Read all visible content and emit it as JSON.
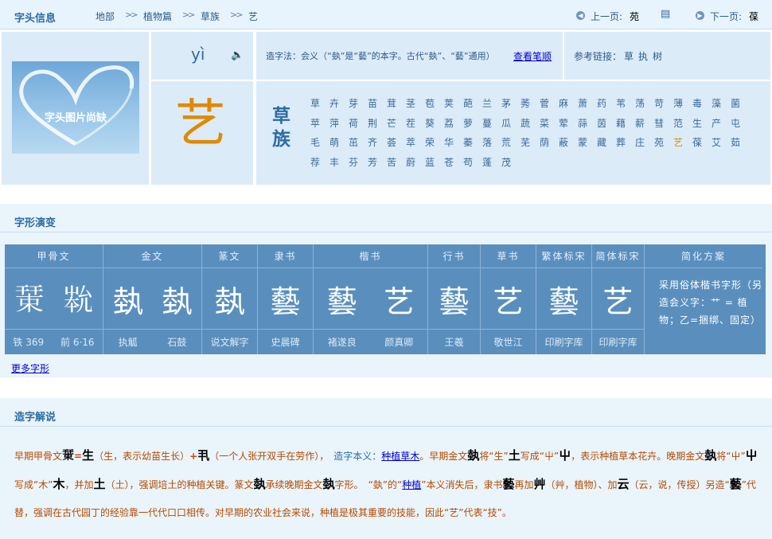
{
  "topbar": {
    "title": "字头信息",
    "bc1": "地部",
    "bc2": "植物篇",
    "bc3": "草族",
    "bc4": "艺",
    "sep": ">>",
    "prev_label": "上一页:",
    "prev_char": "苑",
    "next_label": "下一页:",
    "next_char": "葆"
  },
  "info": {
    "image_caption": "字头图片尚缺",
    "pinyin": "yì",
    "method_text": "造字法：会义（“埶”是“藝”的本字。古代“埶”、“藝”通用）",
    "stroke_link": "查看笔顺",
    "ref_label": "参考链接：",
    "ref1": "草",
    "ref2": "执",
    "ref3": "树",
    "big_char": "艺",
    "radical_name": "草族"
  },
  "radical_chars": [
    "草",
    "卉",
    "芽",
    "苗",
    "茸",
    "茎",
    "苞",
    "荚",
    "葩",
    "兰",
    "茅",
    "莠",
    "菅",
    "麻",
    "萧",
    "药",
    "苇",
    "荡",
    "苛",
    "薄",
    "毒",
    "藻",
    "菌",
    "苹",
    "萍",
    "荷",
    "荆",
    "芒",
    "茬",
    "葵",
    "荔",
    "萝",
    "蔓",
    "瓜",
    "蔬",
    "菜",
    "荤",
    "蒜",
    "茵",
    "藉",
    "薪",
    "彗",
    "范",
    "生",
    "产",
    "屯",
    "毛",
    "萌",
    "茁",
    "齐",
    "荟",
    "萃",
    "荣",
    "华",
    "蓁",
    "落",
    "荒",
    "芜",
    "荫",
    "蔽",
    "蒙",
    "藏",
    "葬",
    "庄",
    "苑",
    "艺",
    "葆",
    "艾",
    "茹",
    "荐",
    "丰",
    "芬",
    "芳",
    "苦",
    "蔚",
    "蓝",
    "苍",
    "苟",
    "蓬",
    "茂"
  ],
  "evolution": {
    "title": "字形演变",
    "more": "更多字形",
    "columns": [
      {
        "h": "甲骨文",
        "g": [
          "𢆞",
          "𡴞"
        ],
        "s": [
          "铁 369",
          "前 6·16"
        ]
      },
      {
        "h": "金文",
        "g": [
          "埶",
          "埶"
        ],
        "s": [
          "执觚",
          "石鼓"
        ]
      },
      {
        "h": "篆文",
        "g": [
          "埶"
        ],
        "s": [
          "说文解字"
        ]
      },
      {
        "h": "隶书",
        "g": [
          "藝"
        ],
        "s": [
          "史晨碑"
        ]
      },
      {
        "h": "楷书",
        "g": [
          "藝",
          "艺"
        ],
        "s": [
          "褚遂良",
          "颜真卿"
        ]
      },
      {
        "h": "行书",
        "g": [
          "藝"
        ],
        "s": [
          "王羲"
        ]
      },
      {
        "h": "草书",
        "g": [
          "艺"
        ],
        "s": [
          "敬世江"
        ]
      },
      {
        "h": "繁体标宋",
        "g": [
          "藝"
        ],
        "s": [
          "印刷字库"
        ]
      },
      {
        "h": "简体标宋",
        "g": [
          "艺"
        ],
        "s": [
          "印刷字库"
        ]
      },
      {
        "h": "简化方案",
        "g": [],
        "s": []
      }
    ],
    "note": "采用俗体楷书字形（另造会义字：艹 = 植物；乙=捆绑、固定）"
  },
  "explanation": {
    "title": "造字解说",
    "p1": "早期甲骨文",
    "p2": "（生，表示幼苗生长）",
    "p3": "（一个人张开双手在劳作），",
    "p4": "造字本义：",
    "p4a": "种植草木",
    "p5": "。早期金文",
    "p6": "将“生”",
    "p7": "写成“屮”",
    "p8": "，表示种植草本花卉。晚期金文",
    "p9": "将“屮”",
    "p10": "写成“木”",
    "p11": "，并加",
    "p12": "（土），强调培土的种植关键。篆文",
    "p13": "承续晚期金文",
    "p14": "字形。",
    "p15": "“埶”的“",
    "p15a": "种植",
    "p15b": "”本义消失后，隶书",
    "p16": "再加",
    "p17": "（艸，植物）、加",
    "p18": "（云，说，传授）另造“",
    "p19": "”代替，强调在古代园丁的经验靠一代代口口相传。对早期的农业社会来说，种植是极其重要的技能，因此“艺”代表“技”。",
    "eq": "=",
    "plus": "+",
    "g_jia": "𢆞",
    "g_sheng": "生",
    "g_ren": "丮",
    "g_jin1": "埶",
    "g_tu": "土",
    "g_che": "屮",
    "g_mu": "木",
    "g_tu2": "土",
    "g_zhuan": "埶",
    "g_jin2": "埶",
    "g_yi": "埶",
    "g_li": "藝",
    "g_cao": "艸",
    "g_yun": "云",
    "g_yi2": "藝"
  }
}
